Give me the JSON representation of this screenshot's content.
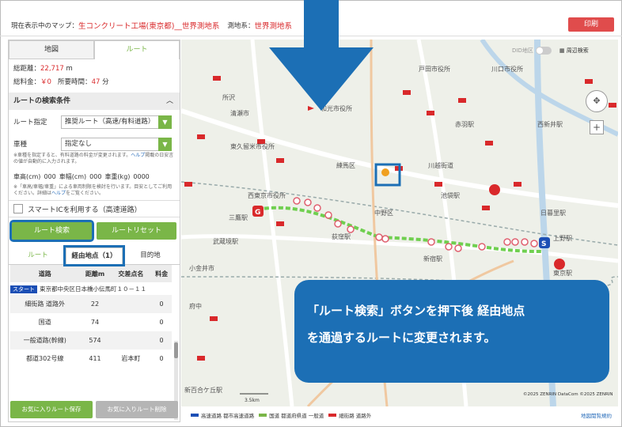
{
  "header": {
    "current_map_label": "現在表示中のマップ：",
    "current_map_value": "生コンクリート工場(東京都)__世界測地系",
    "datum_label": "測地系：",
    "datum_value": "世界測地系",
    "print_label": "印刷"
  },
  "sidebar": {
    "tabs": [
      "地図",
      "ルート"
    ],
    "total_distance_label": "総距離：",
    "total_distance_value": "22,717",
    "total_distance_unit": "m",
    "total_fee_label": "総料金：",
    "total_fee_value": "￥0",
    "time_label": "所要時間：",
    "time_value": "47",
    "time_unit": "分",
    "conditions_title": "ルートの検索条件",
    "route_spec_label": "ルート指定",
    "route_spec_value": "推奨ルート（高速/有料道路）",
    "vehicle_label": "車種",
    "vehicle_value": "指定なし",
    "vehicle_note_a": "※車種を指定すると、有料道路の料金が変更されます。",
    "vehicle_note_link": "ヘルプ",
    "vehicle_note_b": "掲載の日安言の値が自動的に入力されます。",
    "height_label": "車高(cm)",
    "height_value": "000",
    "width_label": "車幅(cm)",
    "width_value": "000",
    "weight_label": "車重(kg)",
    "weight_value": "0000",
    "size_note_a": "※「車高/車幅/車重」による車両制限を検討を行います。目安としてご利用ください。詳細は",
    "size_note_link": "ヘルプ",
    "size_note_b": "をご覧ください。",
    "smart_ic_label": "スマートICを利用する（高速道路）",
    "search_button": "ルート検索",
    "reset_button": "ルートリセット",
    "route_tabs": [
      "ルート",
      "経由地点（1）",
      "目的地"
    ],
    "table_headers": [
      "道路",
      "距離m",
      "交差点名",
      "料金"
    ],
    "start_badge": "スタート",
    "start_address": "東京都中央区日本橋小伝馬町１０－１１",
    "rows": [
      {
        "road": "細街路 道路外",
        "dist": "22",
        "cross": "",
        "fee": "0"
      },
      {
        "road": "国道",
        "dist": "74",
        "cross": "",
        "fee": "0"
      },
      {
        "road": "一般道路(幹線)",
        "dist": "574",
        "cross": "",
        "fee": "0"
      },
      {
        "road": "都道302号線",
        "dist": "411",
        "cross": "岩本町",
        "fee": "0"
      }
    ],
    "fav_save": "お気に入りルート保存",
    "fav_delete": "お気に入りルート削除"
  },
  "map": {
    "did_label": "DID地区",
    "facility_label": "周辺検索",
    "place_labels": [
      "所沢",
      "清瀬市",
      "東久留米市役所",
      "西東京市役所",
      "和光市役所",
      "戸田市役所",
      "川口市役所",
      "赤羽駅",
      "西新井駅",
      "池袋駅",
      "新宿駅",
      "中野区",
      "荻窪駅",
      "武蔵境駅",
      "小金井市",
      "府中",
      "新百合ケ丘駅",
      "上野駅",
      "日暮里駅",
      "東京駅",
      "練馬区",
      "三鷹駅",
      "川越街道"
    ],
    "scale": "3.5km",
    "copyright": "©2025 ZENRIN DataCom ©2025 ZENRIN",
    "legend": [
      "高速道路 都市高速道路",
      "国道 都道府県道 一般道",
      "細街路 道路外"
    ],
    "legend_colors": [
      "#1c4fb5",
      "#7ab648",
      "#d9292b"
    ],
    "terms_link": "地図閲覧規約",
    "marker_s": "S",
    "marker_g": "G"
  },
  "callout": {
    "line1": "「ルート検索」ボタンを押下後 経由地点",
    "line2": "を通過するルートに変更されます。"
  },
  "colors": {
    "accent": "#7ab648",
    "highlight": "#1c6fb5",
    "red": "#d9292b"
  }
}
